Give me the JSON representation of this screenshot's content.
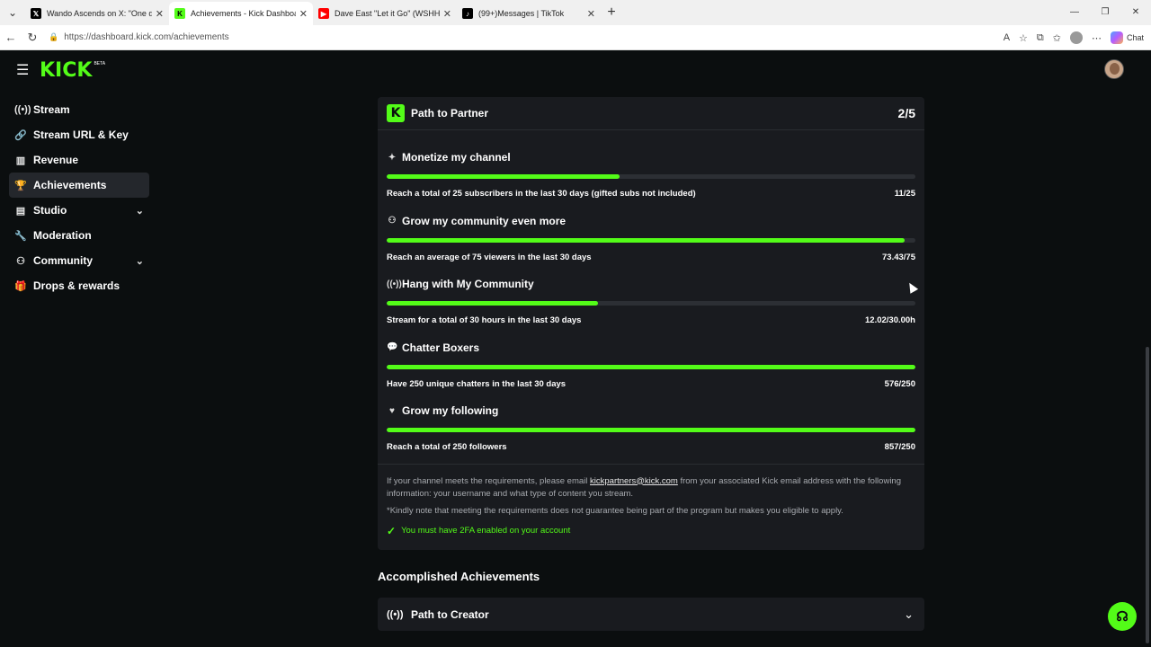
{
  "browser": {
    "tabs": [
      {
        "title": "Wando Ascends on X: \"One day I",
        "icon": "x-logo-icon",
        "active": false
      },
      {
        "title": "Achievements - Kick Dashboard",
        "icon": "kick-logo-icon",
        "active": true
      },
      {
        "title": "Dave East \"Let it Go\" (WSHH Exclu",
        "icon": "youtube-icon",
        "active": false
      },
      {
        "title": "(99+)Messages | TikTok",
        "icon": "tiktok-icon",
        "active": false
      }
    ],
    "url": "https://dashboard.kick.com/achievements",
    "chat_label": "Chat"
  },
  "app": {
    "logo": "KICK",
    "beta": "BETA"
  },
  "sidebar": {
    "items": [
      {
        "label": "Stream",
        "icon": "broadcast-icon",
        "active": false,
        "expandable": false
      },
      {
        "label": "Stream URL & Key",
        "icon": "link-icon",
        "active": false,
        "expandable": false
      },
      {
        "label": "Revenue",
        "icon": "chart-icon",
        "active": false,
        "expandable": false
      },
      {
        "label": "Achievements",
        "icon": "trophy-icon",
        "active": true,
        "expandable": false
      },
      {
        "label": "Studio",
        "icon": "studio-icon",
        "active": false,
        "expandable": true
      },
      {
        "label": "Moderation",
        "icon": "wrench-icon",
        "active": false,
        "expandable": false
      },
      {
        "label": "Community",
        "icon": "community-icon",
        "active": false,
        "expandable": true
      },
      {
        "label": "Drops & rewards",
        "icon": "gift-icon",
        "active": false,
        "expandable": false
      }
    ]
  },
  "partner": {
    "title": "Path to Partner",
    "count": "2/5",
    "goals": [
      {
        "title": "Monetize my channel",
        "icon": "sparkle-icon",
        "description": "Reach a total of 25 subscribers in the last 30 days (gifted subs not included)",
        "progress_text": "11/25",
        "progress": 0.44
      },
      {
        "title": "Grow my community even more",
        "icon": "people-icon",
        "description": "Reach an average of 75 viewers in the last 30 days",
        "progress_text": "73.43/75",
        "progress": 0.979
      },
      {
        "title": "Hang with My Community",
        "icon": "broadcast-icon",
        "description": "Stream for a total of 30 hours in the last 30 days",
        "progress_text": "12.02/30.00h",
        "progress": 0.4
      },
      {
        "title": "Chatter Boxers",
        "icon": "chat-icon",
        "description": "Have 250 unique chatters in the last 30 days",
        "progress_text": "576/250",
        "progress": 1.0
      },
      {
        "title": "Grow my following",
        "icon": "heart-icon",
        "description": "Reach a total of 250 followers",
        "progress_text": "857/250",
        "progress": 1.0
      }
    ],
    "note_1_pre": "If your channel meets the requirements, please email ",
    "note_email": "kickpartners@kick.com",
    "note_1_post": " from your associated Kick email address with the following information: your username and what type of content you stream.",
    "note_2": "*Kindly note that meeting the requirements does not guarantee being part of the program but makes you eligible to apply.",
    "requirement": "You must have 2FA enabled on your account"
  },
  "accomplished": {
    "heading": "Accomplished Achievements",
    "items": [
      {
        "title": "Path to Creator",
        "icon": "broadcast-icon"
      }
    ]
  },
  "colors": {
    "accent": "#53fc18",
    "background": "#0b0e0f",
    "card": "#191b1f"
  }
}
